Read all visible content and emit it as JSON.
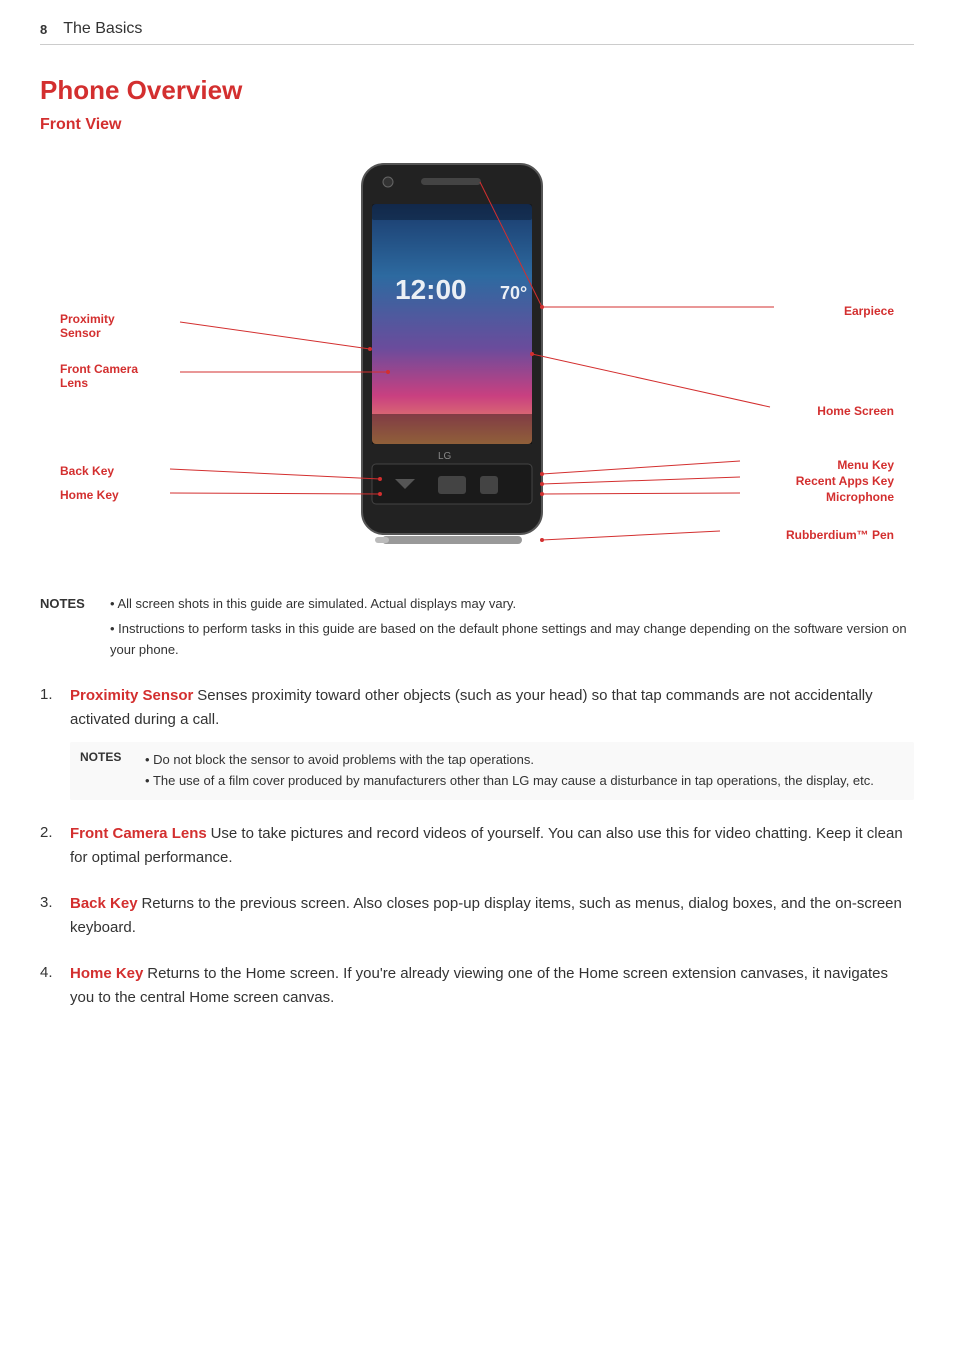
{
  "header": {
    "page_number": "8",
    "title": "The Basics"
  },
  "page_title": "Phone Overview",
  "front_view_label": "Front View",
  "phone_screen": {
    "time": "12:00",
    "temp": "70°"
  },
  "labels": {
    "left": {
      "proximity_sensor": "Proximity\nSensor",
      "front_camera_lens": "Front Camera\nLens",
      "back_key": "Back Key",
      "home_key": "Home Key"
    },
    "right": {
      "earpiece": "Earpiece",
      "home_screen": "Home Screen",
      "menu_key": "Menu Key",
      "recent_apps_key": "Recent Apps Key",
      "microphone": "Microphone",
      "rubberdium_pen": "Rubberdium™ Pen"
    }
  },
  "notes": {
    "label": "NOTES",
    "bullets": [
      "All screen shots in this guide are simulated. Actual displays may vary.",
      "Instructions to perform tasks in this guide are based on the default phone settings and may change depending on the software version on your phone."
    ]
  },
  "list_items": [
    {
      "number": "1.",
      "term": "Proximity Sensor",
      "description": " Senses proximity toward other objects (such as your head) so that tap commands are not accidentally activated during a call.",
      "notes": {
        "label": "NOTES",
        "bullets": [
          "Do not block the sensor to avoid problems with the tap operations.",
          "The use of a film cover produced by manufacturers other than LG may cause a disturbance in tap operations, the display, etc."
        ]
      }
    },
    {
      "number": "2.",
      "term": "Front Camera Lens",
      "description": " Use to take pictures and record videos of yourself. You can also use this for video chatting. Keep it clean for optimal performance.",
      "notes": null
    },
    {
      "number": "3.",
      "term": "Back Key",
      "description": " Returns to the previous screen. Also closes pop-up display items, such as menus, dialog boxes, and the on-screen keyboard.",
      "notes": null
    },
    {
      "number": "4.",
      "term": "Home Key",
      "description": " Returns to the Home screen. If you're already viewing one of the Home screen extension canvases, it navigates you to the central Home screen canvas.",
      "notes": null
    }
  ],
  "colors": {
    "accent": "#d32f2f",
    "text": "#333333"
  }
}
